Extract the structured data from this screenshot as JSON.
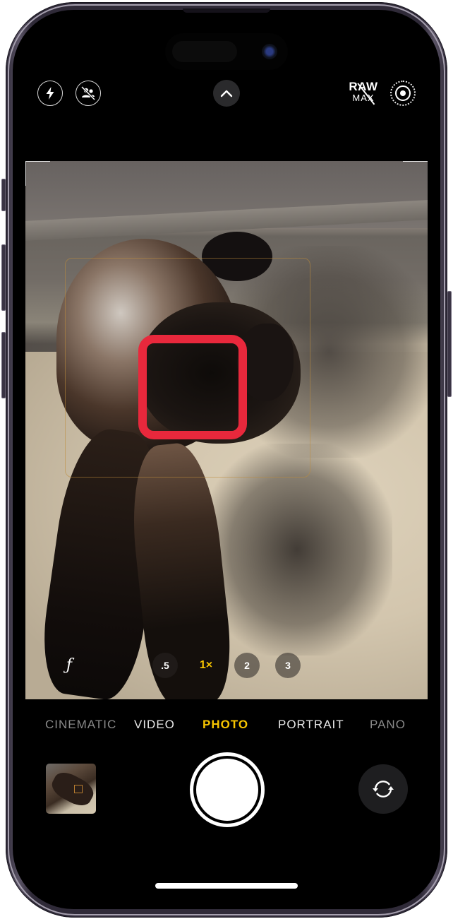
{
  "app": "Camera",
  "top_controls": {
    "flash": {
      "icon": "flash-icon",
      "state": "auto"
    },
    "live_photo": {
      "icon": "live-photo-off-icon",
      "state": "off"
    },
    "expand": {
      "icon": "chevron-up-icon"
    },
    "raw": {
      "label_top": "RAW",
      "label_bottom": "MAX",
      "state": "off"
    },
    "live": {
      "icon": "live-photo-icon",
      "state": "on"
    }
  },
  "viewfinder": {
    "subject": "black cat lying on carpet",
    "focus_indicator_color": "#e8283c",
    "face_detection_color": "#be8c3c"
  },
  "aperture": {
    "label": "ƒ"
  },
  "zoom_levels": [
    {
      "label": ".5",
      "active": false
    },
    {
      "label": "1×",
      "active": true
    },
    {
      "label": "2",
      "active": false
    },
    {
      "label": "3",
      "active": false
    }
  ],
  "modes": [
    {
      "label": "CINEMATIC",
      "active": false
    },
    {
      "label": "VIDEO",
      "active": false
    },
    {
      "label": "PHOTO",
      "active": true
    },
    {
      "label": "PORTRAIT",
      "active": false
    },
    {
      "label": "PANO",
      "active": false
    }
  ],
  "bottom_controls": {
    "thumbnail": {
      "icon": "last-photo-thumbnail"
    },
    "shutter": {
      "icon": "shutter-button"
    },
    "flip": {
      "icon": "camera-flip-icon"
    }
  },
  "colors": {
    "accent": "#f7c500",
    "focus": "#e8283c",
    "background": "#000000"
  }
}
